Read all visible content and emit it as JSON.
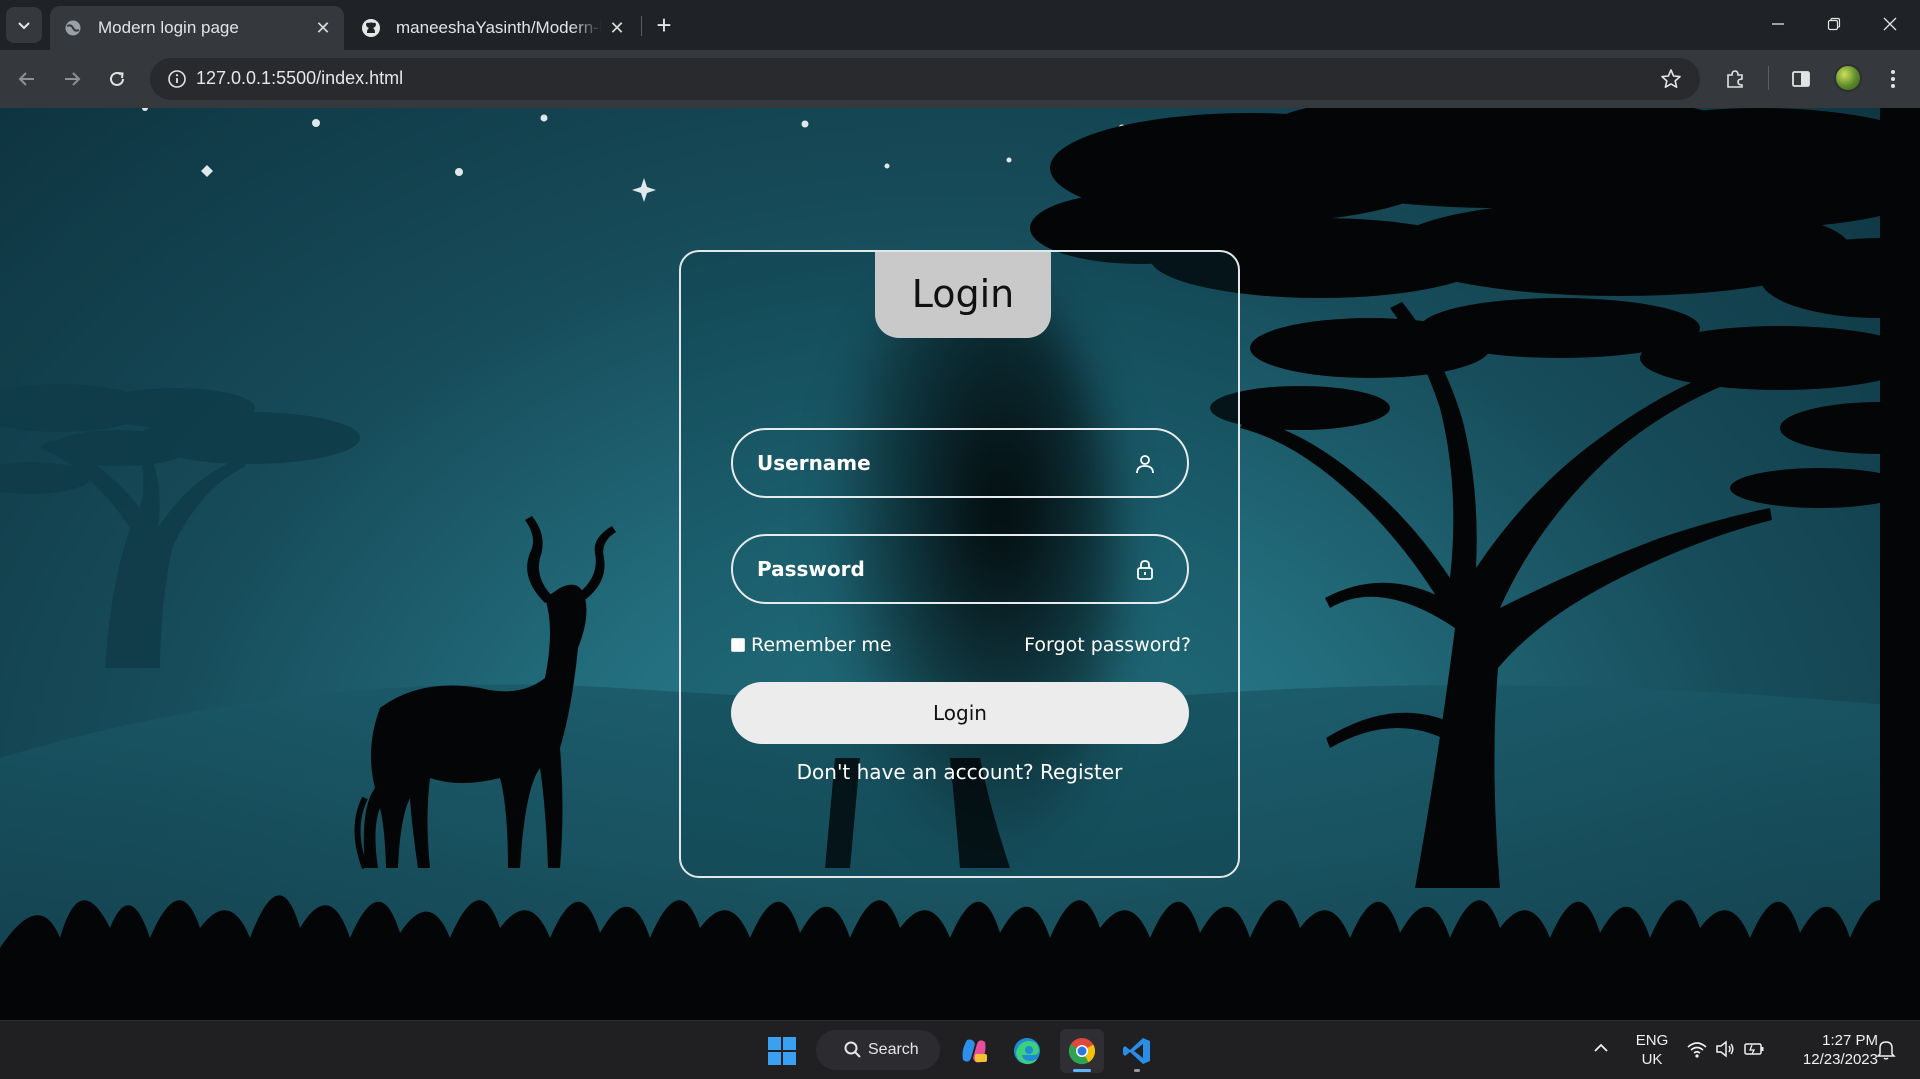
{
  "browser": {
    "tabs": [
      {
        "title": "Modern login page",
        "active": true
      },
      {
        "title": "maneeshaYasinth/Modern-look",
        "active": false
      }
    ],
    "url": "127.0.0.1:5500/index.html"
  },
  "login": {
    "title": "Login",
    "username_placeholder": "Username",
    "password_placeholder": "Password",
    "remember_label": "Remember me",
    "forgot_label": "Forgot password?",
    "button_label": "Login",
    "register_text": "Don't have an account? Register"
  },
  "taskbar": {
    "search_label": "Search",
    "language": "ENG",
    "region": "UK",
    "time": "1:27 PM",
    "date": "12/23/2023"
  },
  "colors": {
    "sky": "#1c5c6b",
    "card_border": "#e2e8ea",
    "login_tab": "#c9c9c9",
    "button": "#ececec"
  }
}
